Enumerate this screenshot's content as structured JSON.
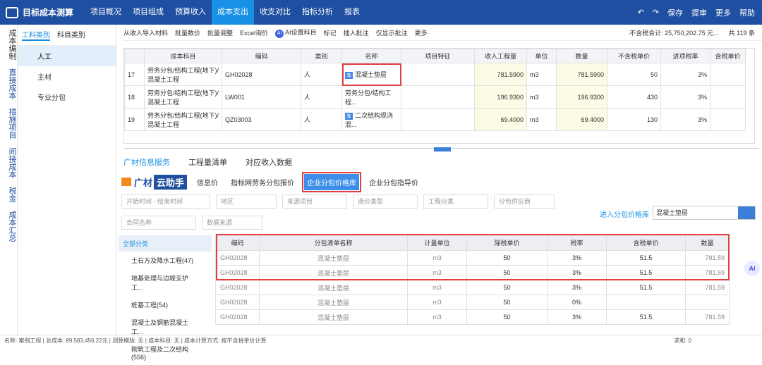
{
  "app": {
    "title": "目标成本测算"
  },
  "nav": [
    "项目概况",
    "项目组成",
    "预算收入",
    "成本支出",
    "收支对比",
    "指标分析",
    "报表"
  ],
  "actions": {
    "save": "保存",
    "mention": "提审",
    "more": "更多",
    "help": "帮助"
  },
  "rail": [
    "成本编制",
    "直接成本",
    "措施项目",
    "间接成本",
    "税金",
    "成本汇总"
  ],
  "tree": {
    "tabs": [
      "工料类别",
      "科目类别"
    ],
    "items": [
      "人工",
      "主材",
      "专业分包"
    ]
  },
  "toolbar": {
    "items": [
      "从收入导入材料",
      "批量数价",
      "批量调整",
      "Excel询价",
      "AI设置科目",
      "标记",
      "插入批注",
      "仅显示批注",
      "更多"
    ],
    "total": "不含税合计: 25,750,202.75 元...",
    "count": "共 119 条"
  },
  "upper": {
    "headers": [
      "成本科目",
      "编码",
      "类别",
      "名称",
      "项目特征",
      "收入工程量",
      "单位",
      "数量",
      "不含税单价",
      "进项税率",
      "含税单价"
    ],
    "rows": [
      {
        "no": "17",
        "subject": "劳务分包/结构工程(地下)/混凝土工程",
        "code": "GH02028",
        "cat": "人",
        "name": "混凝土垫层",
        "qty_in": "781.5900",
        "unit": "m3",
        "qty": "781.5900",
        "price": "50",
        "rate": "3%"
      },
      {
        "no": "18",
        "subject": "劳务分包/结构工程(地下)/混凝土工程",
        "code": "LW001",
        "cat": "人",
        "name": "劳务分包/结构工程...",
        "qty_in": "196.9300",
        "unit": "m3",
        "qty": "196.9300",
        "price": "430",
        "rate": "3%"
      },
      {
        "no": "19",
        "subject": "劳务分包/结构工程(地下)/混凝土工程",
        "code": "QZ03003",
        "cat": "人",
        "name": "二次结构现浇混...",
        "qty_in": "69.4000",
        "unit": "m3",
        "qty": "69.4000",
        "price": "130",
        "rate": "3%"
      }
    ]
  },
  "lowertabs": [
    "广材信息服务",
    "工程量清单",
    "对应收入数据"
  ],
  "brand": {
    "a": "广材",
    "b": "云助手"
  },
  "subtabs": [
    "信息价",
    "指标网劳务分包报价",
    "企业分包价格库",
    "企业分包指导价"
  ],
  "filters": [
    "开始时间",
    "结束时间",
    "地区",
    "来源项目",
    "造价类型",
    "工程分类",
    "分包供应商"
  ],
  "filters2": [
    "合同名称",
    "数据来源"
  ],
  "enter": "进入分包价格库",
  "search": "混凝土垫层",
  "cats": {
    "all": "全部分类",
    "items": [
      "土石方及降水工程(47)",
      "地基处理与边坡支护工...",
      "桩基工程(54)",
      "混凝土及钢筋混凝土工...",
      "砌筑工程及二次结构(556)"
    ]
  },
  "lower": {
    "headers": [
      "编码",
      "分包清单名称",
      "计量单位",
      "除税单价",
      "税率",
      "含税单价",
      "数量"
    ],
    "rows": [
      [
        "GH02028",
        "混凝土垫层",
        "m3",
        "50",
        "3%",
        "51.5",
        "781.59"
      ],
      [
        "GH02028",
        "混凝土垫层",
        "m3",
        "50",
        "3%",
        "51.5",
        "781.59"
      ],
      [
        "GH02028",
        "混凝土垫层",
        "m3",
        "50",
        "3%",
        "51.5",
        "781.59"
      ],
      [
        "GH02028",
        "混凝土垫层",
        "m3",
        "50",
        "0%",
        "",
        ""
      ],
      [
        "GH02028",
        "混凝土垫层",
        "m3",
        "50",
        "3%",
        "51.5",
        "781.59"
      ]
    ]
  },
  "status": "名称: 案例工程 | 总成本: 89,583,456.22元 | 测算模版: 无 | 成本科目: 无 | 成本计算方式: 按不含税单价计算",
  "status_right": "求和: 0"
}
